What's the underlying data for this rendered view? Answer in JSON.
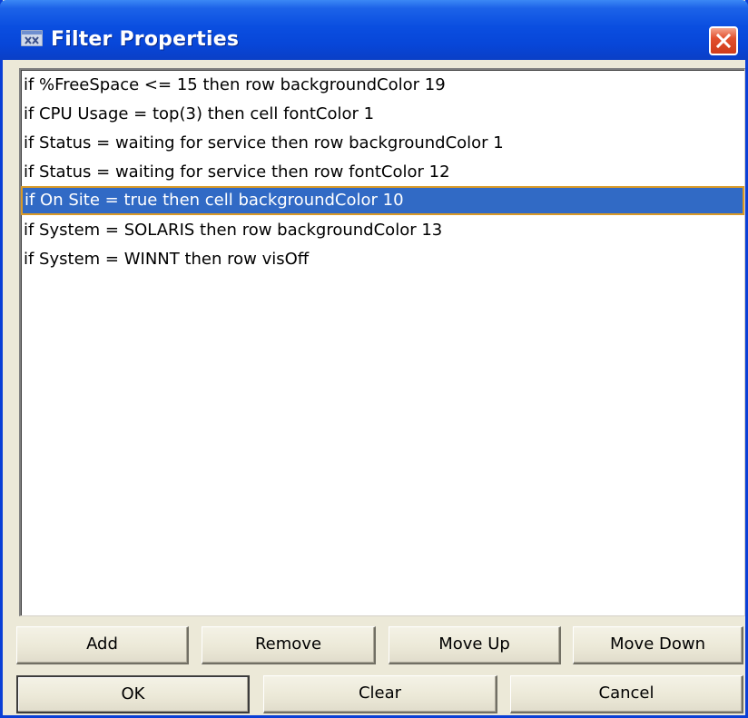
{
  "window": {
    "title": "Filter Properties",
    "icon": "app-icon",
    "close_icon": "close-icon",
    "colors": {
      "titlebar": "#0a4ee0",
      "selection": "#316ac5",
      "selection_border": "#d99a28",
      "close_button": "#e2502e",
      "face": "#ece9d8"
    }
  },
  "rules": {
    "items": [
      {
        "label": "if %FreeSpace <= 15 then row backgroundColor 19"
      },
      {
        "label": "if CPU Usage = top(3) then cell fontColor 1"
      },
      {
        "label": "if Status = waiting for service then row backgroundColor 1"
      },
      {
        "label": "if Status = waiting for service then row fontColor 12"
      },
      {
        "label": "if On Site = true then cell backgroundColor 10"
      },
      {
        "label": "if System = SOLARIS then row backgroundColor 13"
      },
      {
        "label": "if System = WINNT then row visOff"
      }
    ],
    "selected_index": 4
  },
  "buttons": {
    "add": "Add",
    "remove": "Remove",
    "move_up": "Move Up",
    "move_down": "Move Down",
    "ok": "OK",
    "clear": "Clear",
    "cancel": "Cancel"
  }
}
